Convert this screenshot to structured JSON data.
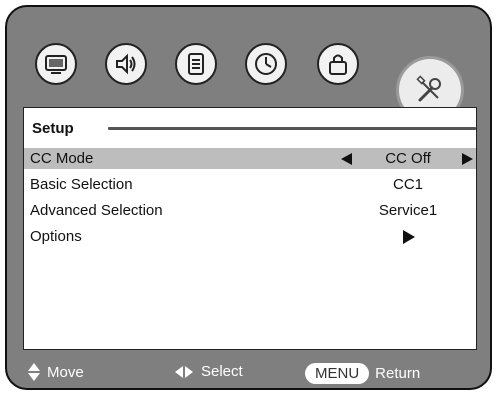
{
  "icons": [
    {
      "name": "picture-icon",
      "active": false
    },
    {
      "name": "audio-icon",
      "active": false
    },
    {
      "name": "channel-list-icon",
      "active": false
    },
    {
      "name": "clock-icon",
      "active": false
    },
    {
      "name": "lock-icon",
      "active": false
    },
    {
      "name": "setup-tools-icon",
      "active": true
    }
  ],
  "panel": {
    "title": "Setup",
    "rows": [
      {
        "label": "CC Mode",
        "value": "CC Off",
        "selected": true
      },
      {
        "label": "Basic Selection",
        "value": "CC1",
        "selected": false
      },
      {
        "label": "Advanced Selection",
        "value": "Service1",
        "selected": false
      },
      {
        "label": "Options",
        "value": "",
        "selected": false
      }
    ]
  },
  "footer": {
    "move_label": "Move",
    "select_label": "Select",
    "menu_key": "MENU",
    "return_label": "Return"
  }
}
